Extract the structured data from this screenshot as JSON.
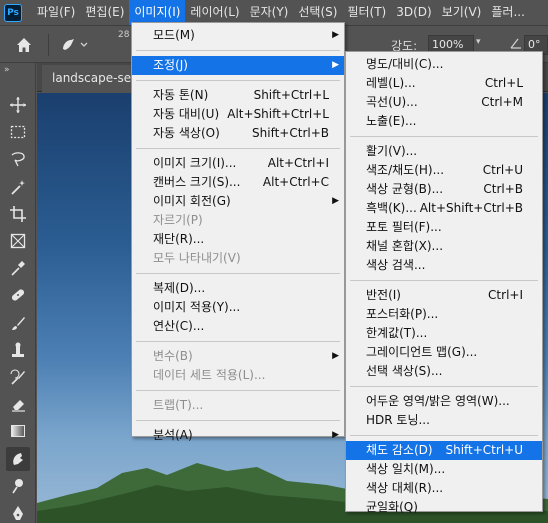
{
  "app": {
    "logo": "Ps"
  },
  "menubar": {
    "items": [
      "파일(F)",
      "편집(E)",
      "이미지(I)",
      "레이어(L)",
      "문자(Y)",
      "선택(S)",
      "필터(T)",
      "3D(D)",
      "보기(V)",
      "플러..."
    ],
    "active_index": 2
  },
  "options_bar": {
    "brush_size": "28",
    "strength_label": "강도:",
    "strength_value": "100%",
    "angle_value": "0°"
  },
  "document": {
    "tab_title": "landscape-sea"
  },
  "image_menu": {
    "items": [
      {
        "label": "모드(M)",
        "shortcut": "",
        "submenu": true,
        "disabled": false
      },
      {
        "sep": true
      },
      {
        "label": "조정(J)",
        "shortcut": "",
        "submenu": true,
        "disabled": false,
        "highlighted": true
      },
      {
        "sep": true
      },
      {
        "label": "자동 톤(N)",
        "shortcut": "Shift+Ctrl+L"
      },
      {
        "label": "자동 대비(U)",
        "shortcut": "Alt+Shift+Ctrl+L"
      },
      {
        "label": "자동 색상(O)",
        "shortcut": "Shift+Ctrl+B"
      },
      {
        "sep": true
      },
      {
        "label": "이미지 크기(I)...",
        "shortcut": "Alt+Ctrl+I"
      },
      {
        "label": "캔버스 크기(S)...",
        "shortcut": "Alt+Ctrl+C"
      },
      {
        "label": "이미지 회전(G)",
        "shortcut": "",
        "submenu": true
      },
      {
        "label": "자르기(P)",
        "shortcut": "",
        "disabled": true
      },
      {
        "label": "재단(R)...",
        "shortcut": ""
      },
      {
        "label": "모두 나타내기(V)",
        "shortcut": "",
        "disabled": true
      },
      {
        "sep": true
      },
      {
        "label": "복제(D)...",
        "shortcut": ""
      },
      {
        "label": "이미지 적용(Y)...",
        "shortcut": ""
      },
      {
        "label": "연산(C)...",
        "shortcut": ""
      },
      {
        "sep": true
      },
      {
        "label": "변수(B)",
        "shortcut": "",
        "submenu": true,
        "disabled": true
      },
      {
        "label": "데이터 세트 적용(L)...",
        "shortcut": "",
        "disabled": true
      },
      {
        "sep": true
      },
      {
        "label": "트랩(T)...",
        "shortcut": "",
        "disabled": true
      },
      {
        "sep": true
      },
      {
        "label": "분석(A)",
        "shortcut": "",
        "submenu": true
      }
    ]
  },
  "adjust_menu": {
    "items": [
      {
        "label": "명도/대비(C)...",
        "shortcut": ""
      },
      {
        "label": "레벨(L)...",
        "shortcut": "Ctrl+L"
      },
      {
        "label": "곡선(U)...",
        "shortcut": "Ctrl+M"
      },
      {
        "label": "노출(E)...",
        "shortcut": ""
      },
      {
        "sep": true
      },
      {
        "label": "활기(V)...",
        "shortcut": ""
      },
      {
        "label": "색조/채도(H)...",
        "shortcut": "Ctrl+U"
      },
      {
        "label": "색상 균형(B)...",
        "shortcut": "Ctrl+B"
      },
      {
        "label": "흑백(K)...",
        "shortcut": "Alt+Shift+Ctrl+B"
      },
      {
        "label": "포토 필터(F)...",
        "shortcut": ""
      },
      {
        "label": "채널 혼합(X)...",
        "shortcut": ""
      },
      {
        "label": "색상 검색...",
        "shortcut": ""
      },
      {
        "sep": true
      },
      {
        "label": "반전(I)",
        "shortcut": "Ctrl+I"
      },
      {
        "label": "포스터화(P)...",
        "shortcut": ""
      },
      {
        "label": "한계값(T)...",
        "shortcut": ""
      },
      {
        "label": "그레이디언트 맵(G)...",
        "shortcut": ""
      },
      {
        "label": "선택 색상(S)...",
        "shortcut": ""
      },
      {
        "sep": true
      },
      {
        "label": "어두운 영역/밝은 영역(W)...",
        "shortcut": ""
      },
      {
        "label": "HDR 토닝...",
        "shortcut": ""
      },
      {
        "sep": true
      },
      {
        "label": "채도 감소(D)",
        "shortcut": "Shift+Ctrl+U",
        "highlighted": true
      },
      {
        "label": "색상 일치(M)...",
        "shortcut": ""
      },
      {
        "label": "색상 대체(R)...",
        "shortcut": ""
      },
      {
        "label": "균일화(Q)",
        "shortcut": ""
      }
    ]
  },
  "toolbar": {
    "tools": [
      "move-tool-icon",
      "marquee-tool-icon",
      "lasso-tool-icon",
      "magic-wand-icon",
      "crop-tool-icon",
      "frame-tool-icon",
      "eyedropper-icon",
      "healing-brush-icon",
      "brush-tool-icon",
      "clone-stamp-icon",
      "history-brush-icon",
      "eraser-icon",
      "gradient-icon",
      "smudge-tool-icon",
      "dodge-tool-icon",
      "pen-tool-icon"
    ],
    "selected_index": 13
  },
  "colors": {
    "accent": "#1473e6",
    "menu_bg": "#f0f0f0",
    "chrome": "#535353"
  }
}
